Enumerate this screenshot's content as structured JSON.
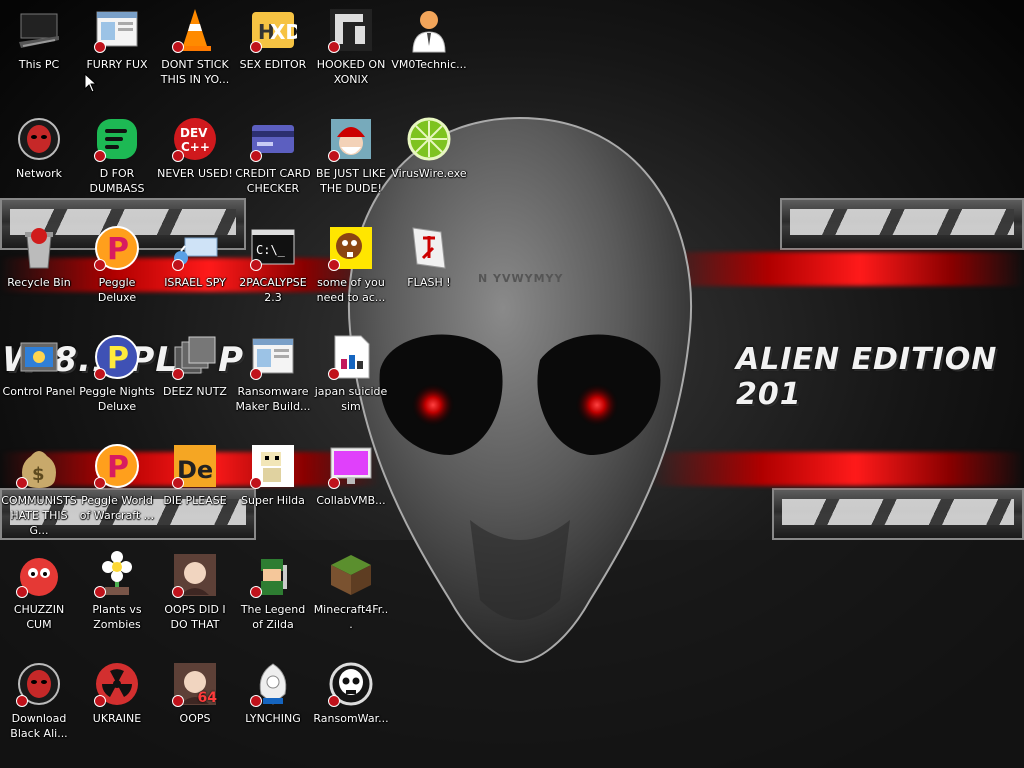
{
  "wallpaper": {
    "left_text": "W 8.1 PLA P",
    "right_text": "ALIEN EDITION 201",
    "mask_text": "N YVWYMYY"
  },
  "icons": [
    {
      "label": "This PC",
      "icon": "computer-icon",
      "shortcut": false
    },
    {
      "label": "FURRY FUX",
      "icon": "window-app-icon",
      "shortcut": true
    },
    {
      "label": "DONT STICK THIS IN YO...",
      "icon": "traffic-cone-icon",
      "shortcut": true
    },
    {
      "label": "SEX EDITOR",
      "icon": "hxd-editor-icon",
      "shortcut": true
    },
    {
      "label": "HOOKED ON XONIX",
      "icon": "xonix-game-icon",
      "shortcut": true
    },
    {
      "label": "VM0Technic...",
      "icon": "doctor-person-icon",
      "shortcut": false
    },
    {
      "label": "Network",
      "icon": "alien-head-icon",
      "shortcut": false
    },
    {
      "label": "D FOR DUMBASS",
      "icon": "green-chat-icon",
      "shortcut": true
    },
    {
      "label": "NEVER USED!",
      "icon": "devcpp-icon",
      "shortcut": true
    },
    {
      "label": "CREDIT CARD CHECKER",
      "icon": "credit-card-icon",
      "shortcut": true
    },
    {
      "label": "BE JUST LIKE THE DUDE!",
      "icon": "santa-icon",
      "shortcut": true
    },
    {
      "label": "VirusWire.exe",
      "icon": "lime-icon",
      "shortcut": false
    },
    {
      "label": "Recycle Bin",
      "icon": "recycle-bin-icon",
      "shortcut": false
    },
    {
      "label": "Peggle Deluxe",
      "icon": "peggle-icon",
      "shortcut": true
    },
    {
      "label": "ISRAEL SPY",
      "icon": "network-spy-icon",
      "shortcut": true
    },
    {
      "label": "2PACALYPSE 2.3",
      "icon": "terminal-icon",
      "shortcut": true
    },
    {
      "label": "some of you need to ac...",
      "icon": "beaver-icon",
      "shortcut": true
    },
    {
      "label": "FLASH !",
      "icon": "flash-icon",
      "shortcut": false
    },
    {
      "label": "Control Panel",
      "icon": "control-panel-icon",
      "shortcut": false
    },
    {
      "label": "Peggle Nights Deluxe",
      "icon": "peggle-nights-icon",
      "shortcut": true
    },
    {
      "label": "DEEZ NUTZ",
      "icon": "stacked-windows-icon",
      "shortcut": true
    },
    {
      "label": "Ransomware Maker Build...",
      "icon": "window-app-icon",
      "shortcut": true
    },
    {
      "label": "japan suicide sim",
      "icon": "document-icon",
      "shortcut": true
    },
    {
      "label": "COMMUNISTS HATE THIS G...",
      "icon": "money-bag-icon",
      "shortcut": true
    },
    {
      "label": "Peggle World of Warcraft ...",
      "icon": "peggle-icon",
      "shortcut": true
    },
    {
      "label": "DIE PLEASE",
      "icon": "de-letters-icon",
      "shortcut": true
    },
    {
      "label": "Super Hilda",
      "icon": "pixel-character-icon",
      "shortcut": true
    },
    {
      "label": "CollabVMB...",
      "icon": "pink-monitor-icon",
      "shortcut": true
    },
    {
      "label": "CHUZZIN CUM",
      "icon": "chuzzle-icon",
      "shortcut": true
    },
    {
      "label": "Plants vs Zombies",
      "icon": "flower-icon",
      "shortcut": true
    },
    {
      "label": "OOPS DID I DO THAT",
      "icon": "portrait-icon",
      "shortcut": true
    },
    {
      "label": "The Legend of Zilda",
      "icon": "pixel-hero-icon",
      "shortcut": true
    },
    {
      "label": "Minecraft4Fr...",
      "icon": "grass-block-icon",
      "shortcut": false
    },
    {
      "label": "Download Black Ali...",
      "icon": "alien-head-icon",
      "shortcut": true
    },
    {
      "label": "UKRAINE",
      "icon": "radiation-icon",
      "shortcut": true
    },
    {
      "label": "OOPS",
      "icon": "portrait-64-icon",
      "shortcut": true
    },
    {
      "label": "LYNCHING",
      "icon": "emblem-icon",
      "shortcut": true
    },
    {
      "label": "RansomWar...",
      "icon": "skull-ring-icon",
      "shortcut": true
    }
  ],
  "badge_64": "64"
}
